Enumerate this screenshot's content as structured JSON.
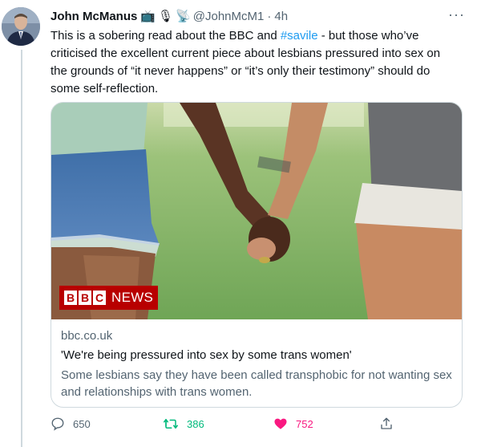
{
  "tweet": {
    "author_name": "John McManus",
    "author_emojis": [
      "📺",
      "🎙",
      "📡"
    ],
    "handle": "@JohnMcM1",
    "separator": "·",
    "time": "4h",
    "more": "···",
    "text_before": "This is a sobering read about the BBC and ",
    "hashtag": "#savile",
    "text_after": " - but those who’ve criticised the excellent current piece about lesbians pressured into sex on the grounds of “it never happens” or “it’s only their testimony” should do some self-reflection."
  },
  "card": {
    "badge_letters": [
      "B",
      "B",
      "C"
    ],
    "badge_news": "NEWS",
    "domain": "bbc.co.uk",
    "title": "'We're being pressured into sex by some trans women'",
    "description": "Some lesbians say they have been called transphobic for not wanting sex and relationships with trans women."
  },
  "actions": {
    "replies": "650",
    "retweets": "386",
    "likes": "752"
  },
  "colors": {
    "link": "#1d9bf0",
    "retweet": "#00ba7c",
    "like": "#f91880",
    "bbc_red": "#b80000",
    "muted": "#536471"
  },
  "icons": [
    "reply-icon",
    "retweet-icon",
    "heart-icon",
    "share-icon",
    "more-icon"
  ]
}
